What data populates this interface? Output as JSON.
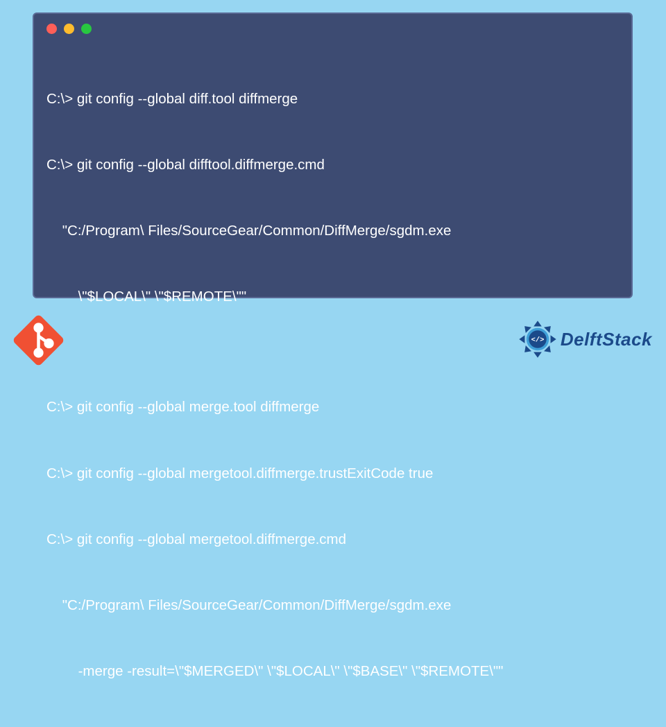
{
  "terminal": {
    "lines": [
      "C:\\> git config --global diff.tool diffmerge",
      "C:\\> git config --global difftool.diffmerge.cmd",
      "    \"C:/Program\\ Files/SourceGear/Common/DiffMerge/sgdm.exe",
      "        \\\"$LOCAL\\\" \\\"$REMOTE\\\"\"",
      "",
      "C:\\> git config --global merge.tool diffmerge",
      "C:\\> git config --global mergetool.diffmerge.trustExitCode true",
      "C:\\> git config --global mergetool.diffmerge.cmd",
      "    \"C:/Program\\ Files/SourceGear/Common/DiffMerge/sgdm.exe",
      "        -merge -result=\\\"$MERGED\\\" \\\"$LOCAL\\\" \\\"$BASE\\\" \\\"$REMOTE\\\"\""
    ]
  },
  "brand": {
    "name": "DelftStack"
  },
  "colors": {
    "background": "#97d6f2",
    "terminal_bg": "#3d4b72",
    "git_orange": "#f05033",
    "brand_blue": "#1b4a8a"
  }
}
